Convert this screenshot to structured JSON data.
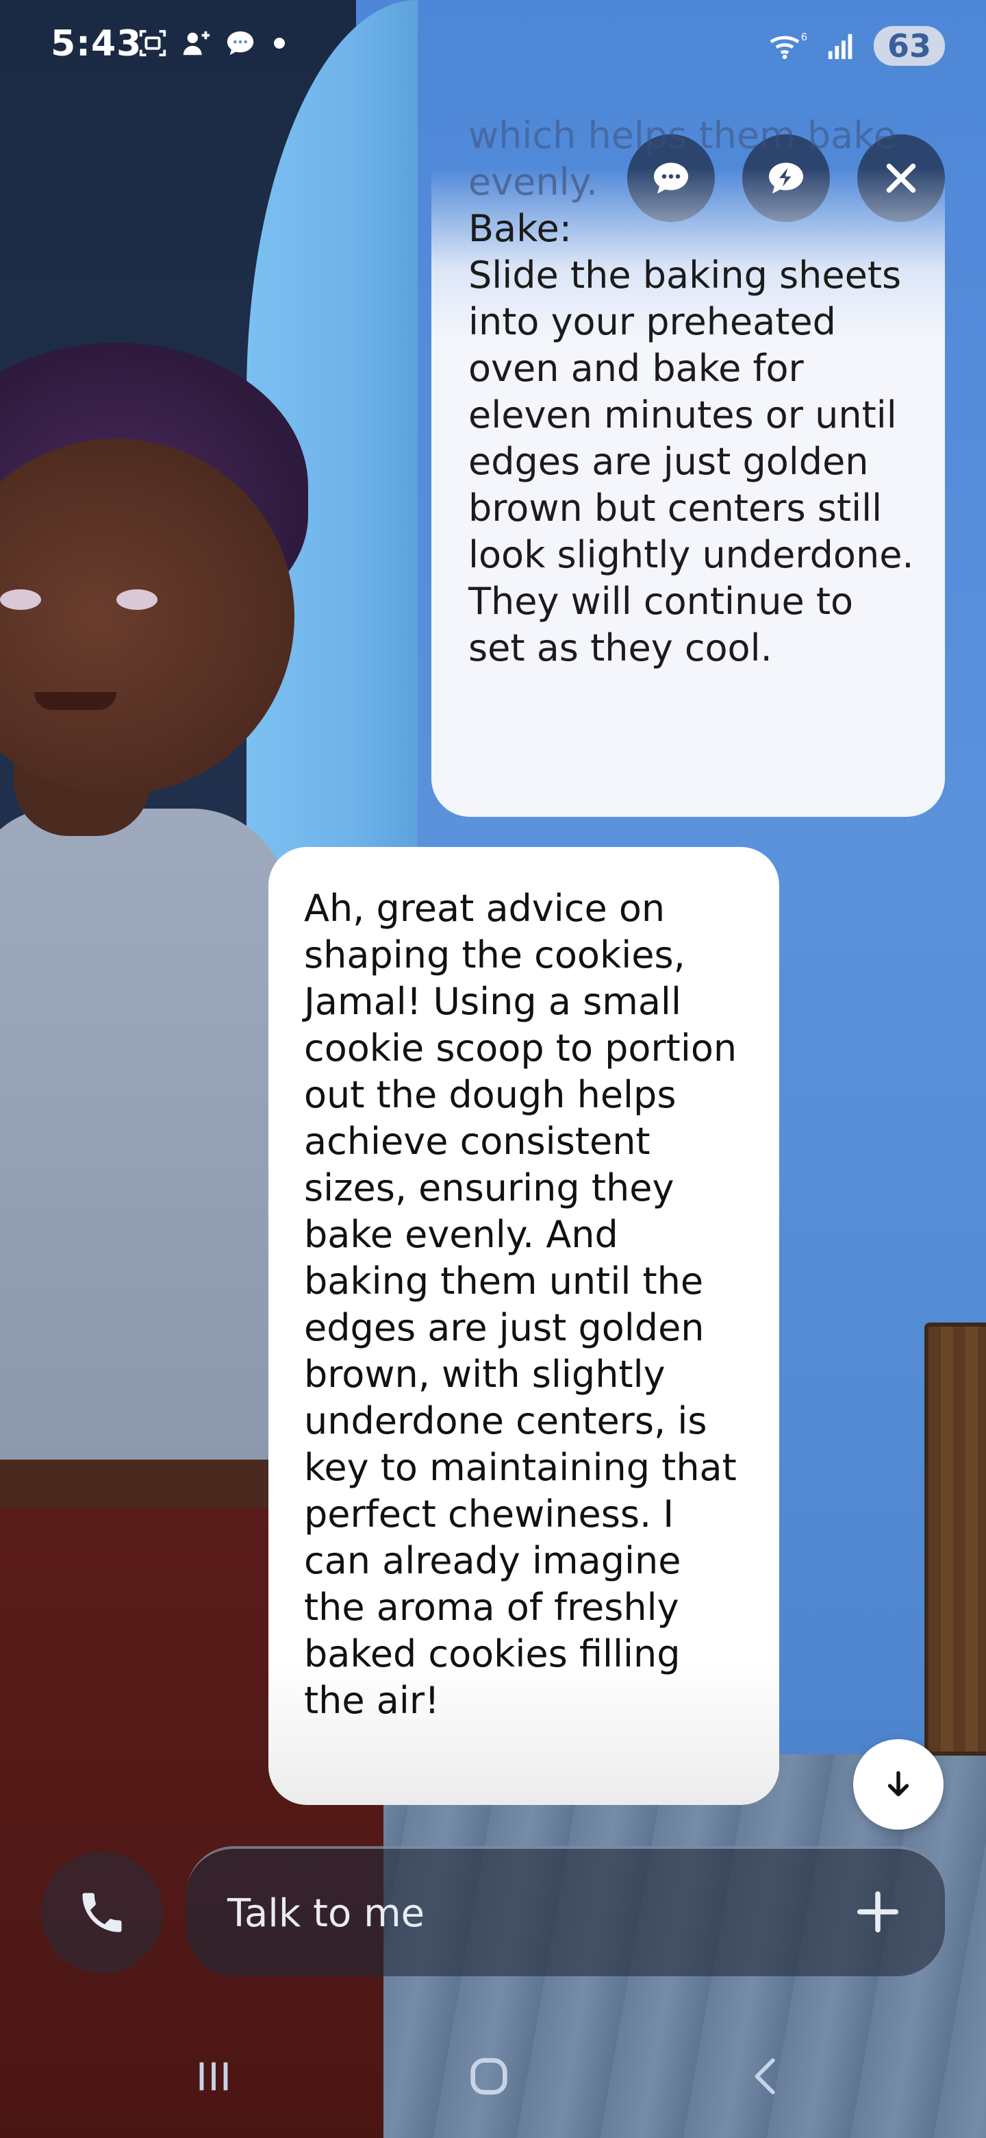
{
  "status_bar": {
    "time": "5:43",
    "battery": "63",
    "network": "6"
  },
  "chat": {
    "partial_message": {
      "faded_lines": [
        "which helps them bake",
        "evenly."
      ],
      "heading": "Bake:",
      "body": "Slide the baking sheets into your preheated oven and bake for eleven minutes or until edges are just golden brown but centers still look slightly underdone. They will continue to set as they cool."
    },
    "ai_message": "Ah, great advice on shaping the cookies, Jamal! Using a small cookie scoop to portion out the dough helps achieve consistent sizes, ensuring they bake evenly. And baking them until the edges are just golden brown, with slightly underdone centers, is key to maintaining that perfect chewiness. I can already imagine the aroma of freshly baked cookies filling the air!"
  },
  "composer": {
    "placeholder": "Talk to me"
  },
  "icons": {
    "chat": "chat-bubble-icon",
    "quick": "lightning-bubble-icon",
    "close": "close-icon",
    "scroll": "arrow-down-icon",
    "call": "phone-icon",
    "add": "plus-icon",
    "recents": "recent-apps-icon",
    "home": "home-icon",
    "back": "back-icon"
  },
  "colors": {
    "bubble": "#ffffff",
    "button_dark": "#263a5c",
    "wall": "#5b8fd4"
  }
}
